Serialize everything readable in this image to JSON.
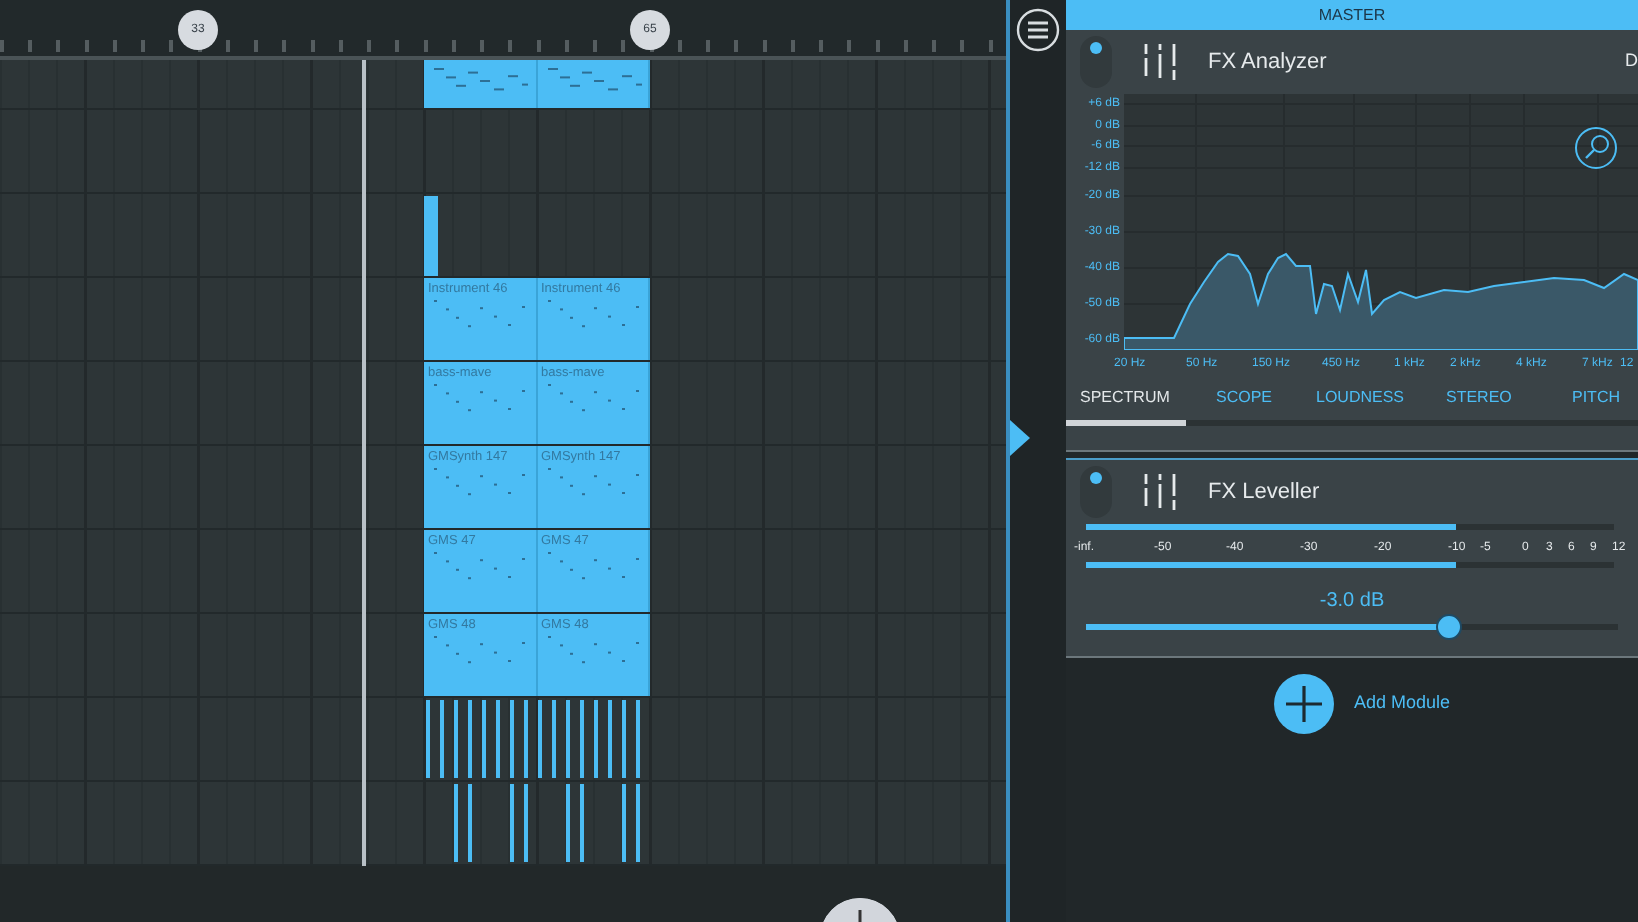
{
  "timeline": {
    "markers": [
      "33",
      "65"
    ],
    "tracks": [
      {
        "kind": "notes"
      },
      {
        "kind": "empty"
      },
      {
        "kind": "stub"
      },
      {
        "kind": "labeled",
        "clips": [
          "Instrument 46",
          "Instrument 46"
        ]
      },
      {
        "kind": "labeled",
        "clips": [
          "bass-mave",
          "bass-mave"
        ]
      },
      {
        "kind": "labeled",
        "clips": [
          "GMSynth 147",
          "GMSynth 147"
        ]
      },
      {
        "kind": "labeled",
        "clips": [
          "GMS 47",
          "GMS 47"
        ]
      },
      {
        "kind": "labeled",
        "clips": [
          "GMS 48",
          "GMS 48"
        ]
      },
      {
        "kind": "drums"
      },
      {
        "kind": "drums_sparse"
      }
    ]
  },
  "master": {
    "title": "MASTER",
    "modules": [
      {
        "kind": "analyzer",
        "title": "FX Analyzer",
        "enabled": true,
        "corner_text": "D",
        "db_labels": [
          "+6 dB",
          "0 dB",
          "-6 dB",
          "-12 dB",
          "-20 dB",
          "-30 dB",
          "-40 dB",
          "-50 dB",
          "-60 dB"
        ],
        "freq_labels": [
          "20 Hz",
          "50 Hz",
          "150 Hz",
          "450 Hz",
          "1 kHz",
          "2 kHz",
          "4 kHz",
          "7 kHz",
          "12"
        ],
        "tabs": [
          {
            "label": "SPECTRUM",
            "selected": true
          },
          {
            "label": "SCOPE",
            "selected": false
          },
          {
            "label": "LOUDNESS",
            "selected": false
          },
          {
            "label": "STEREO",
            "selected": false
          },
          {
            "label": "PITCH",
            "selected": false
          }
        ]
      },
      {
        "kind": "leveller",
        "title": "FX Leveller",
        "enabled": true,
        "meters": [
          {
            "level": 0.7
          },
          {
            "level": 0.7
          }
        ],
        "scale": [
          "-inf.",
          "-50",
          "-40",
          "-30",
          "-20",
          "-10",
          "-5",
          "0",
          "3",
          "6",
          "9",
          "12"
        ],
        "reading": "-3.0 dB",
        "gain": {
          "level": 0.68
        }
      }
    ],
    "add_label": "Add Module"
  }
}
